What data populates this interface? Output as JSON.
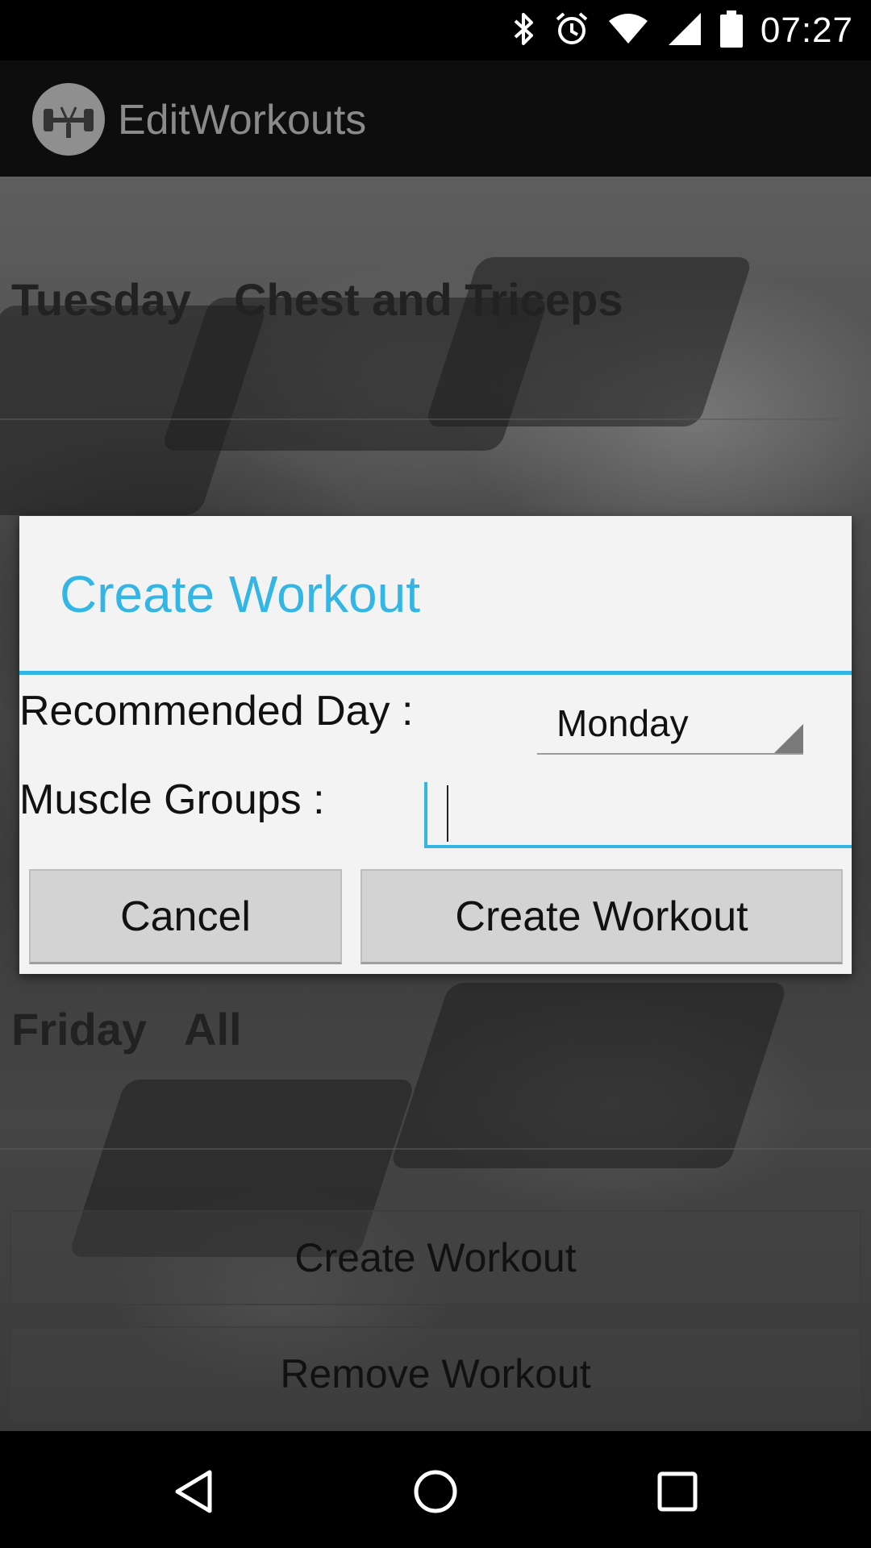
{
  "status_bar": {
    "time": "07:27",
    "icons": [
      "bluetooth-icon",
      "alarm-icon",
      "wifi-icon",
      "signal-icon",
      "battery-icon"
    ]
  },
  "action_bar": {
    "title": "EditWorkouts",
    "logo_icon": "dumbbell-logo-icon"
  },
  "workouts": [
    {
      "day": "Tuesday",
      "muscles": "Chest and Triceps"
    },
    {
      "day": "Friday",
      "muscles": "All"
    }
  ],
  "page_buttons": {
    "create": "Create Workout",
    "remove": "Remove Workout"
  },
  "dialog": {
    "title": "Create Workout",
    "recommended_day_label": "Recommended Day :",
    "recommended_day_value": "Monday",
    "muscle_groups_label": "Muscle Groups :",
    "muscle_groups_value": "",
    "cancel_label": "Cancel",
    "confirm_label": "Create Workout"
  },
  "colors": {
    "accent": "#33b5e5",
    "dialog_bg": "#f3f3f3",
    "button_bg": "#d3d3d3"
  },
  "nav_bar": {
    "icons": [
      "back-icon",
      "home-icon",
      "recents-icon"
    ]
  }
}
